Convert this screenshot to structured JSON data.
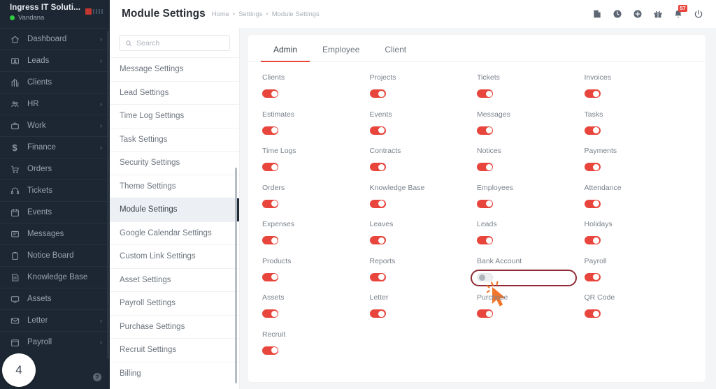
{
  "sidebar": {
    "org_name": "Ingress IT Soluti...",
    "user_name": "Vandana",
    "badge_count": "4",
    "help_glyph": "?",
    "items": [
      {
        "label": "Dashboard",
        "icon": "home-icon",
        "caret": "›"
      },
      {
        "label": "Leads",
        "icon": "lead-card-icon",
        "caret": "›"
      },
      {
        "label": "Clients",
        "icon": "building-icon",
        "caret": ""
      },
      {
        "label": "HR",
        "icon": "people-icon",
        "caret": "›"
      },
      {
        "label": "Work",
        "icon": "briefcase-icon",
        "caret": "›"
      },
      {
        "label": "Finance",
        "icon": "dollar-icon",
        "caret": "›"
      },
      {
        "label": "Orders",
        "icon": "cart-icon",
        "caret": ""
      },
      {
        "label": "Tickets",
        "icon": "headset-icon",
        "caret": ""
      },
      {
        "label": "Events",
        "icon": "calendar-icon",
        "caret": ""
      },
      {
        "label": "Messages",
        "icon": "message-icon",
        "caret": ""
      },
      {
        "label": "Notice Board",
        "icon": "clipboard-icon",
        "caret": ""
      },
      {
        "label": "Knowledge Base",
        "icon": "book-icon",
        "caret": ""
      },
      {
        "label": "Assets",
        "icon": "monitor-icon",
        "caret": ""
      },
      {
        "label": "Letter",
        "icon": "envelope-icon",
        "caret": "›"
      },
      {
        "label": "Payroll",
        "icon": "payroll-calendar-icon",
        "caret": "›"
      }
    ]
  },
  "topbar": {
    "title": "Module Settings",
    "breadcrumbs": [
      "Home",
      "Settings",
      "Module Settings"
    ],
    "separator": "•",
    "icons": [
      {
        "name": "search-icon"
      },
      {
        "name": "note-icon"
      },
      {
        "name": "clock-icon"
      },
      {
        "name": "plus-circle-icon"
      },
      {
        "name": "gift-icon"
      },
      {
        "name": "bell-icon",
        "badge": "57"
      },
      {
        "name": "power-icon"
      }
    ]
  },
  "settings_panel": {
    "search_placeholder": "Search",
    "search_value": "",
    "active_item": "Module Settings",
    "items": [
      "Message Settings",
      "Lead Settings",
      "Time Log Settings",
      "Task Settings",
      "Security Settings",
      "Theme Settings",
      "Module Settings",
      "Google Calendar Settings",
      "Custom Link Settings",
      "Asset Settings",
      "Payroll Settings",
      "Purchase Settings",
      "Recruit Settings",
      "Billing"
    ]
  },
  "main": {
    "tabs": [
      {
        "label": "Admin",
        "active": true
      },
      {
        "label": "Employee",
        "active": false
      },
      {
        "label": "Client",
        "active": false
      }
    ],
    "modules": [
      {
        "label": "Clients",
        "enabled": true
      },
      {
        "label": "Projects",
        "enabled": true
      },
      {
        "label": "Tickets",
        "enabled": true
      },
      {
        "label": "Invoices",
        "enabled": true
      },
      {
        "label": "Estimates",
        "enabled": true
      },
      {
        "label": "Events",
        "enabled": true
      },
      {
        "label": "Messages",
        "enabled": true
      },
      {
        "label": "Tasks",
        "enabled": true
      },
      {
        "label": "Time Logs",
        "enabled": true
      },
      {
        "label": "Contracts",
        "enabled": true
      },
      {
        "label": "Notices",
        "enabled": true
      },
      {
        "label": "Payments",
        "enabled": true
      },
      {
        "label": "Orders",
        "enabled": true
      },
      {
        "label": "Knowledge Base",
        "enabled": true
      },
      {
        "label": "Employees",
        "enabled": true
      },
      {
        "label": "Attendance",
        "enabled": true
      },
      {
        "label": "Expenses",
        "enabled": true
      },
      {
        "label": "Leaves",
        "enabled": true
      },
      {
        "label": "Leads",
        "enabled": true
      },
      {
        "label": "Holidays",
        "enabled": true
      },
      {
        "label": "Products",
        "enabled": true
      },
      {
        "label": "Reports",
        "enabled": true
      },
      {
        "label": "Bank Account",
        "enabled": false,
        "highlighted": true
      },
      {
        "label": "Payroll",
        "enabled": true
      },
      {
        "label": "Assets",
        "enabled": true
      },
      {
        "label": "Letter",
        "enabled": true
      },
      {
        "label": "Purchase",
        "enabled": true
      },
      {
        "label": "QR Code",
        "enabled": true
      },
      {
        "label": "Recruit",
        "enabled": true
      }
    ]
  },
  "colors": {
    "accent_red": "#e8453c",
    "sidebar_bg": "#1d2733",
    "highlight_outline": "#8e2b34",
    "cursor": "#f2752a",
    "status_online": "#2ecc40"
  }
}
